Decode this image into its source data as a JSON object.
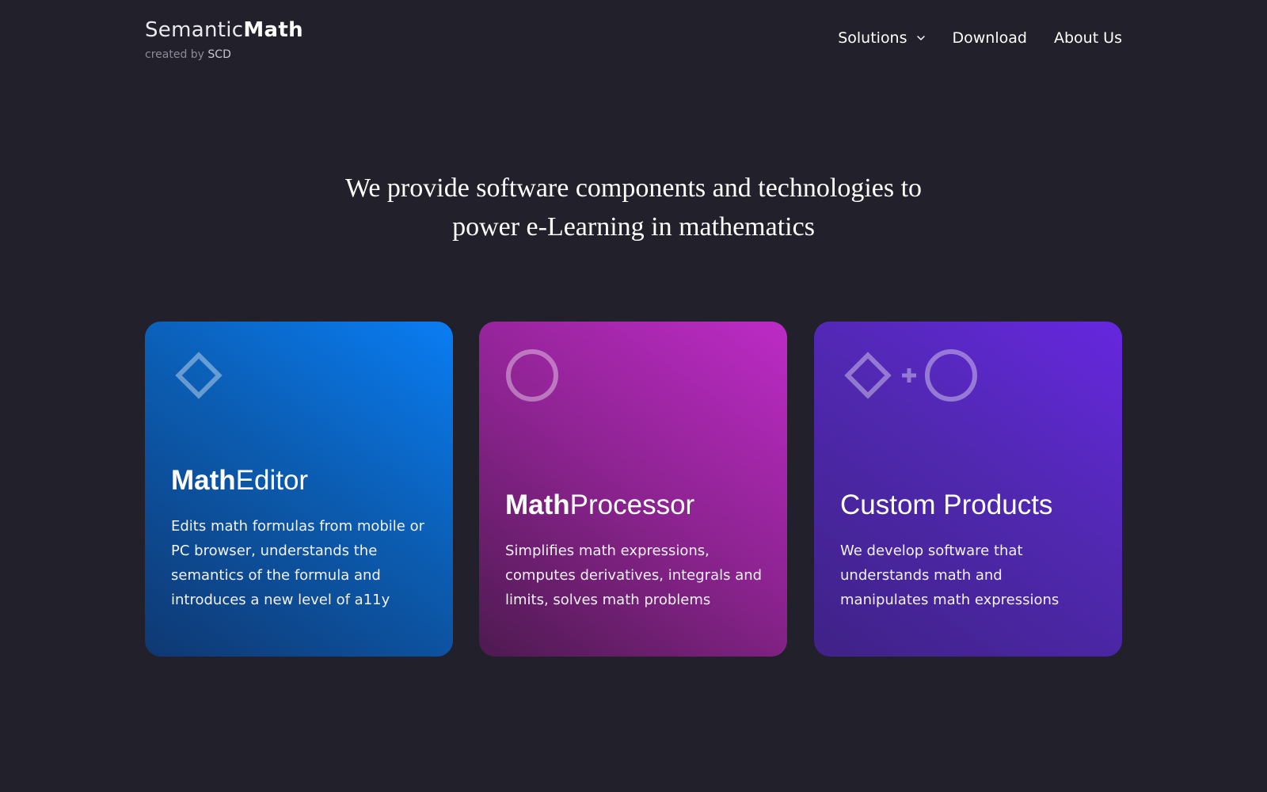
{
  "header": {
    "logo": {
      "main_light": "Semantic",
      "main_bold": "Math",
      "sub_prefix": "created by",
      "sub_brand": "SCD"
    },
    "nav": [
      {
        "label": "Solutions",
        "has_dropdown": true,
        "icon": "chevron-down-icon"
      },
      {
        "label": "Download"
      },
      {
        "label": "About Us"
      }
    ]
  },
  "hero": {
    "line1": "We provide software components and technologies to",
    "line2": "power e-Learning in mathematics"
  },
  "cards": [
    {
      "title_bold": "Math",
      "title_light": "Editor",
      "description": "Edits math formulas from mobile or PC browser, understands the semantics of the formula and introduces a new level of a11y",
      "icon": "diamond-icon",
      "colors": [
        "#0a7df3",
        "#0f3872"
      ]
    },
    {
      "title_bold": "Math",
      "title_light": "Processor",
      "description": "Simplifies math expressions, computes derivatives, integrals and limits, solves math problems",
      "icon": "circle-icon",
      "colors": [
        "#bd2bc6",
        "#4e1a50"
      ]
    },
    {
      "title_bold": "",
      "title_light": "Custom Products",
      "description": "We develop software that understands math and manipulates math expressions",
      "icon": "diamond-plus-circle-icon",
      "colors": [
        "#6627df",
        "#3f2287"
      ]
    }
  ],
  "colors": {
    "background": "#21202b",
    "text": "#ffffff",
    "logo_sub": "#8c8c99"
  }
}
